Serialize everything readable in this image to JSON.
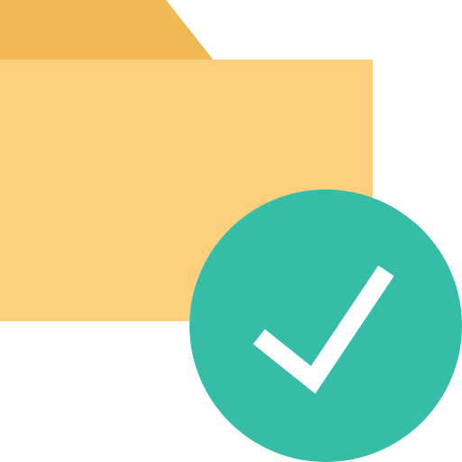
{
  "icon": {
    "name": "folder-check-icon",
    "folder": {
      "icon_name": "folder-icon",
      "tab_color": "#F0B954",
      "body_color": "#FDD07E"
    },
    "badge": {
      "icon_name": "checkmark-icon",
      "circle_color": "#35BDA8",
      "check_color": "#FFFFFF"
    }
  }
}
